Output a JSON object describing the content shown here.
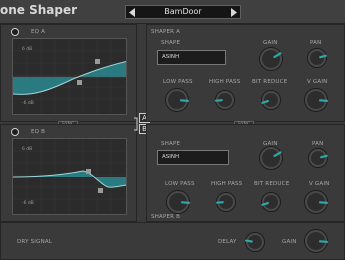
{
  "app": {
    "title": "one Shaper",
    "preset": "BamDoor"
  },
  "colors": {
    "accent": "#2fa7a7",
    "knob_body": "#4a4a4a",
    "screen_bg": "#2b2b2b"
  },
  "eq_a": {
    "label": "EQ A",
    "db_top": "6 dB",
    "db_bottom": "-6 dB",
    "sync": "SYNC"
  },
  "eq_b": {
    "label": "EQ B",
    "db_top": "6 dB",
    "db_bottom": "-6 dB"
  },
  "shaper_a": {
    "title": "SHAPER A",
    "shape_label": "SHAPE",
    "shape_value": "ASINH",
    "gain_label": "GAIN",
    "pan_label": "PAN",
    "low_pass_label": "LOW PASS",
    "high_pass_label": "HIGH PASS",
    "bit_reduce_label": "BIT REDUCE",
    "v_gain_label": "V GAIN",
    "sync": "SYNC",
    "knobs": {
      "gain": 0.72,
      "pan": 0.78,
      "low_pass": 0.85,
      "high_pass": 0.15,
      "bit_reduce": 0.1,
      "v_gain": 0.85
    }
  },
  "shaper_b": {
    "title": "SHAPER B",
    "shape_label": "SHAPE",
    "shape_value": "ASINH",
    "gain_label": "GAIN",
    "pan_label": "PAN",
    "low_pass_label": "LOW PASS",
    "high_pass_label": "HIGH PASS",
    "bit_reduce_label": "BIT REDUCE",
    "v_gain_label": "V GAIN",
    "knobs": {
      "gain": 0.72,
      "pan": 0.78,
      "low_pass": 0.85,
      "high_pass": 0.15,
      "bit_reduce": 0.1,
      "v_gain": 0.85
    }
  },
  "ab_switch": {
    "a": "A",
    "b": "B"
  },
  "dry": {
    "title": "DRY SIGNAL",
    "delay_label": "DELAY",
    "gain_label": "GAIN",
    "knobs": {
      "delay": 0.2,
      "gain": 0.85
    }
  }
}
